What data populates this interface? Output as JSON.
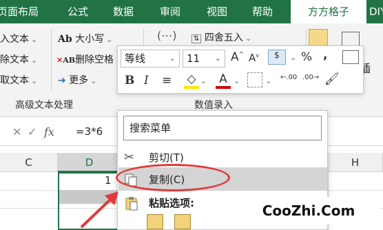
{
  "tabs": [
    "页面布局",
    "公式",
    "数据",
    "审阅",
    "视图",
    "帮助",
    "方方格子",
    "DIY"
  ],
  "ribbon": {
    "left_items": [
      "入文本",
      "除文本",
      "取文本"
    ],
    "mid_items": [
      "大小写",
      "删除空格",
      "更多"
    ],
    "ab_prefix": "Ab",
    "ab_red_prefix": "AB",
    "round_label": "四舍五入",
    "group_titles": [
      "高级文本处理",
      "数值录入"
    ],
    "right_fragment": "插"
  },
  "formula_bar": {
    "fx": "fx",
    "formula": "=3*6"
  },
  "sheet": {
    "columns": [
      "C",
      "D",
      "H"
    ],
    "cell_partial_value": "1"
  },
  "mini_toolbar": {
    "font_name": "等线",
    "font_size": "11",
    "percent": "%",
    "comma": ",",
    "increase_decimal": ".00",
    "decrease_decimal": ".00"
  },
  "context_menu": {
    "search_label": "搜索菜单",
    "items": [
      {
        "label": "剪切(T)",
        "icon": "scissors-icon"
      },
      {
        "label": "复制(C)",
        "icon": "copy-icon"
      },
      {
        "label": "粘贴选项:",
        "icon": "paste-icon"
      }
    ]
  },
  "watermark": "CooZhi.Com",
  "colors": {
    "accent": "#217346",
    "highlight": "#d4d4d4",
    "annotation": "#e03a3a"
  }
}
